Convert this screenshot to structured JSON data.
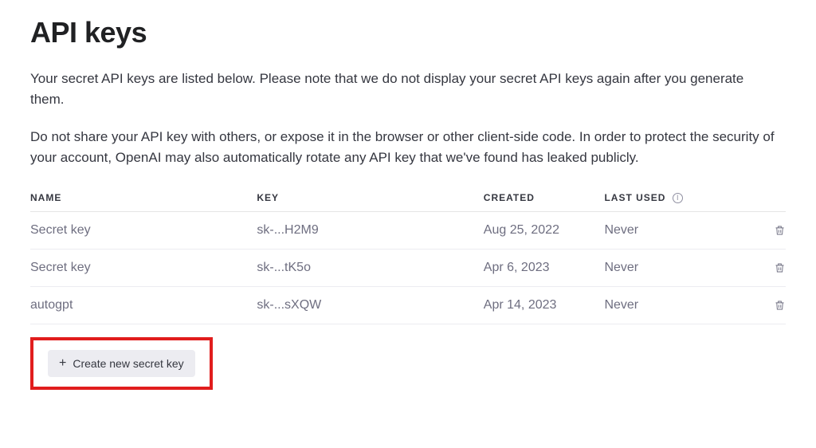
{
  "page": {
    "title": "API keys",
    "description1": "Your secret API keys are listed below. Please note that we do not display your secret API keys again after you generate them.",
    "description2": "Do not share your API key with others, or expose it in the browser or other client-side code. In order to protect the security of your account, OpenAI may also automatically rotate any API key that we've found has leaked publicly."
  },
  "table": {
    "headers": {
      "name": "NAME",
      "key": "KEY",
      "created": "CREATED",
      "last_used": "LAST USED"
    },
    "rows": [
      {
        "name": "Secret key",
        "key": "sk-...H2M9",
        "created": "Aug 25, 2022",
        "last_used": "Never"
      },
      {
        "name": "Secret key",
        "key": "sk-...tK5o",
        "created": "Apr 6, 2023",
        "last_used": "Never"
      },
      {
        "name": "autogpt",
        "key": "sk-...sXQW",
        "created": "Apr 14, 2023",
        "last_used": "Never"
      }
    ]
  },
  "actions": {
    "create_label": "Create new secret key"
  }
}
